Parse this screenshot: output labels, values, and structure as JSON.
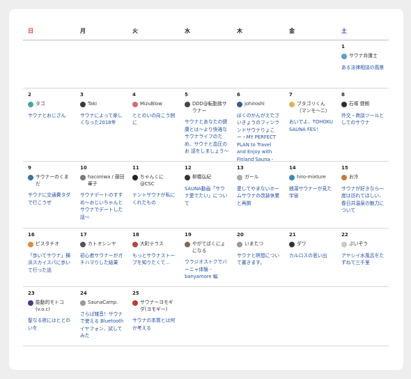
{
  "weekdays": [
    "日",
    "月",
    "火",
    "水",
    "木",
    "金",
    "土"
  ],
  "colors": {
    "sunday": "#d32f2f",
    "saturday": "#1f4ea3",
    "link": "#1f4ea3"
  },
  "weeks": [
    [
      null,
      null,
      null,
      null,
      null,
      null,
      {
        "day": "1",
        "author": "サウナ弁護士",
        "title": "ある法律相談の風景",
        "avatar": "#5aa0c8"
      }
    ],
    [
      {
        "day": "2",
        "author": "タゴ",
        "title": "サウナとおじさん",
        "avatar": "#4aa6a0"
      },
      {
        "day": "3",
        "author": "Taki",
        "title": "サウナによって楽しくなった2018年",
        "avatar": "#3a3a3a"
      },
      {
        "day": "4",
        "author": "MizuBlow",
        "title": "ととのいの向こう側に",
        "avatar": "#d96b6b"
      },
      {
        "day": "5",
        "author": "DDD@転勤族サウナー",
        "title": "サウナとあなたの健康とは〜より快適なサウナライフのため、サウナと血圧のお 話をしましょう〜",
        "avatar": "#444444"
      },
      {
        "day": "6",
        "author": "johiroshi",
        "title": "ぼくのかんがえたさいきょうのフィンランドサウナりょこー・MY PERFECT PLAN to Travel and Enjoy with Finland Sauna -",
        "avatar": "#3b5a8c"
      },
      {
        "day": "7",
        "author": "ブタゴリくん（マンモ〜ニ）",
        "title": "おいでよ、TOHOKU SAUNA FES！",
        "avatar": "#e0b25a"
      },
      {
        "day": "8",
        "author": "石塚 健朗",
        "title": "外交・商談ツールとしてのサウナ",
        "avatar": "#2d2d2d"
      }
    ],
    [
      {
        "day": "9",
        "author": "サウナーのくまだ",
        "title": "サウナに交通費タダで行こうぜ",
        "avatar": "#3f6fa8"
      },
      {
        "day": "10",
        "author": "haconiwa / 藤田 華子",
        "title": "サウナデートのすすめ〜おじいちゃんとサウナでデートした話〜",
        "avatar": "#7a7a7a"
      },
      {
        "day": "11",
        "author": "ちゃんくに@CSC",
        "title": "テントサウナが私にくれたもの",
        "avatar": "#222222"
      },
      {
        "day": "12",
        "author": "柳橋弘紀",
        "title": "SAUNA動画「サウナ愛でたい」について",
        "avatar": "#333333"
      },
      {
        "day": "13",
        "author": "ガール",
        "title": "愛してやまないホームサウナの改装休業と再開",
        "avatar": "#aaaaaa"
      },
      {
        "day": "14",
        "author": "hiro-mixture",
        "title": "銭湯サウナーが見た宇宙",
        "avatar": "#3d87b8"
      },
      {
        "day": "15",
        "author": "お冷",
        "title": "サウナが好きなら一度は訪れてほしい、春日井温泉の魅力について",
        "avatar": "#c77a3a"
      }
    ],
    [
      {
        "day": "16",
        "author": "ピスタチオ",
        "title": "「歩いてサウナ」横浜スカイスパに歩いて行った話",
        "avatar": "#e08a3c"
      },
      {
        "day": "17",
        "author": "カトオシンヤ",
        "title": "初心者サウナーがガチハマりした結果",
        "avatar": "#555555"
      },
      {
        "day": "18",
        "author": "大町テラス",
        "title": "もっとサウナストーブを知りたくて…",
        "avatar": "#b04848"
      },
      {
        "day": "19",
        "author": "やがてぱくにょになる",
        "title": "ウラジオストクでバーニャ体験 - banyamore 編",
        "avatar": "#7a6a55"
      },
      {
        "day": "20",
        "author": "いまたつ",
        "title": "サウナと瞑想について書きます。",
        "avatar": "#999999"
      },
      {
        "day": "21",
        "author": "ダワ",
        "title": "カルロスの思い出",
        "avatar": "#333333"
      },
      {
        "day": "22",
        "author": "ぷいぞう",
        "title": "アヤシイ水風呂をたずねて三千里",
        "avatar": "#c9c9c9"
      }
    ],
    [
      {
        "day": "23",
        "author": "能動的モトコ(v.o.c)",
        "title": "聖なる夜にはととのいを",
        "avatar": "#4a3a8c"
      },
      {
        "day": "24",
        "author": "SaunaCamp.",
        "title": "さらば雑音！サウナで使える Bluetoothイヤフォン、試してみた",
        "avatar": "#9a9a9a"
      },
      {
        "day": "25",
        "author": "サウナーヨモギダ(ヨモギー)",
        "title": "サウナの本質とは何か考える",
        "avatar": "#c0392b"
      },
      null,
      null,
      null,
      null
    ]
  ]
}
